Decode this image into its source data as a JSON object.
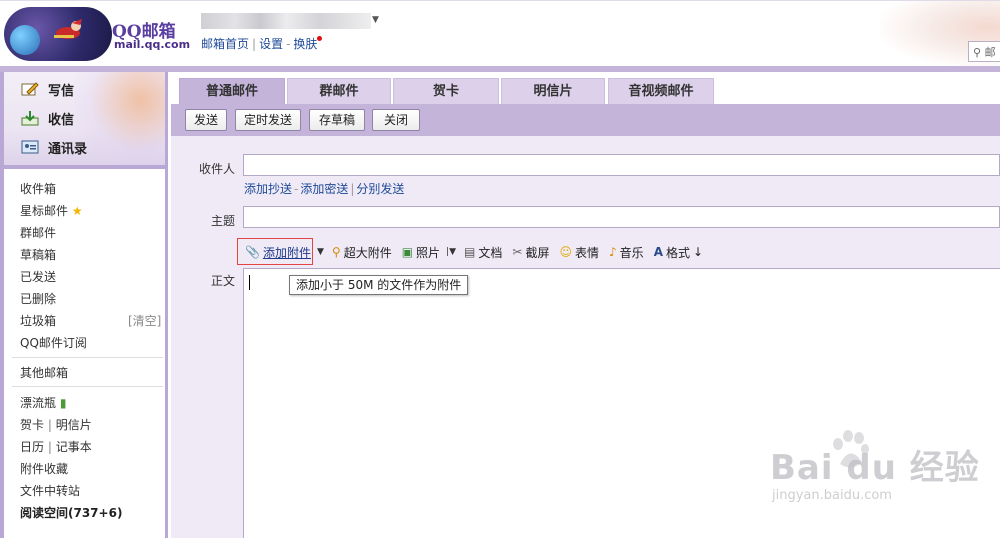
{
  "header": {
    "logo_text": "QQ邮箱",
    "logo_sub": "mail.qq.com",
    "links": [
      "邮箱首页",
      "设置",
      "换肤"
    ],
    "search_placeholder": "邮"
  },
  "sidebar": {
    "actions": [
      {
        "label": "写信",
        "icon": "pencil-icon"
      },
      {
        "label": "收信",
        "icon": "inbox-download-icon"
      },
      {
        "label": "通讯录",
        "icon": "contacts-card-icon"
      }
    ],
    "folders": [
      "收件箱",
      "星标邮件",
      "群邮件",
      "草稿箱",
      "已发送",
      "已删除",
      "垃圾箱",
      "QQ邮件订阅"
    ],
    "trash_clear": "[清空]",
    "other_mailbox": "其他邮箱",
    "extras": {
      "drift_bottle": "漂流瓶",
      "greeting_card": "贺卡",
      "postcard": "明信片",
      "calendar": "日历",
      "notepad": "记事本",
      "attachment_collection": "附件收藏",
      "file_transfer": "文件中转站",
      "reading_space": "阅读空间(737+6)"
    }
  },
  "tabs": [
    "普通邮件",
    "群邮件",
    "贺卡",
    "明信片",
    "音视频邮件"
  ],
  "toolbar": {
    "send": "发送",
    "schedule": "定时发送",
    "save_draft": "存草稿",
    "close": "关闭"
  },
  "compose": {
    "to_label": "收件人",
    "cc_links": [
      "添加抄送",
      "添加密送",
      "分别发送"
    ],
    "subject_label": "主题",
    "body_label": "正文",
    "attach_items": [
      "添加附件",
      "超大附件",
      "照片",
      "文档",
      "截屏",
      "表情",
      "音乐",
      "格式"
    ],
    "attach_tooltip": "添加小于 50M 的文件作为附件"
  },
  "watermark": {
    "main": "Bai du 经验",
    "sub": "jingyan.baidu.com"
  }
}
